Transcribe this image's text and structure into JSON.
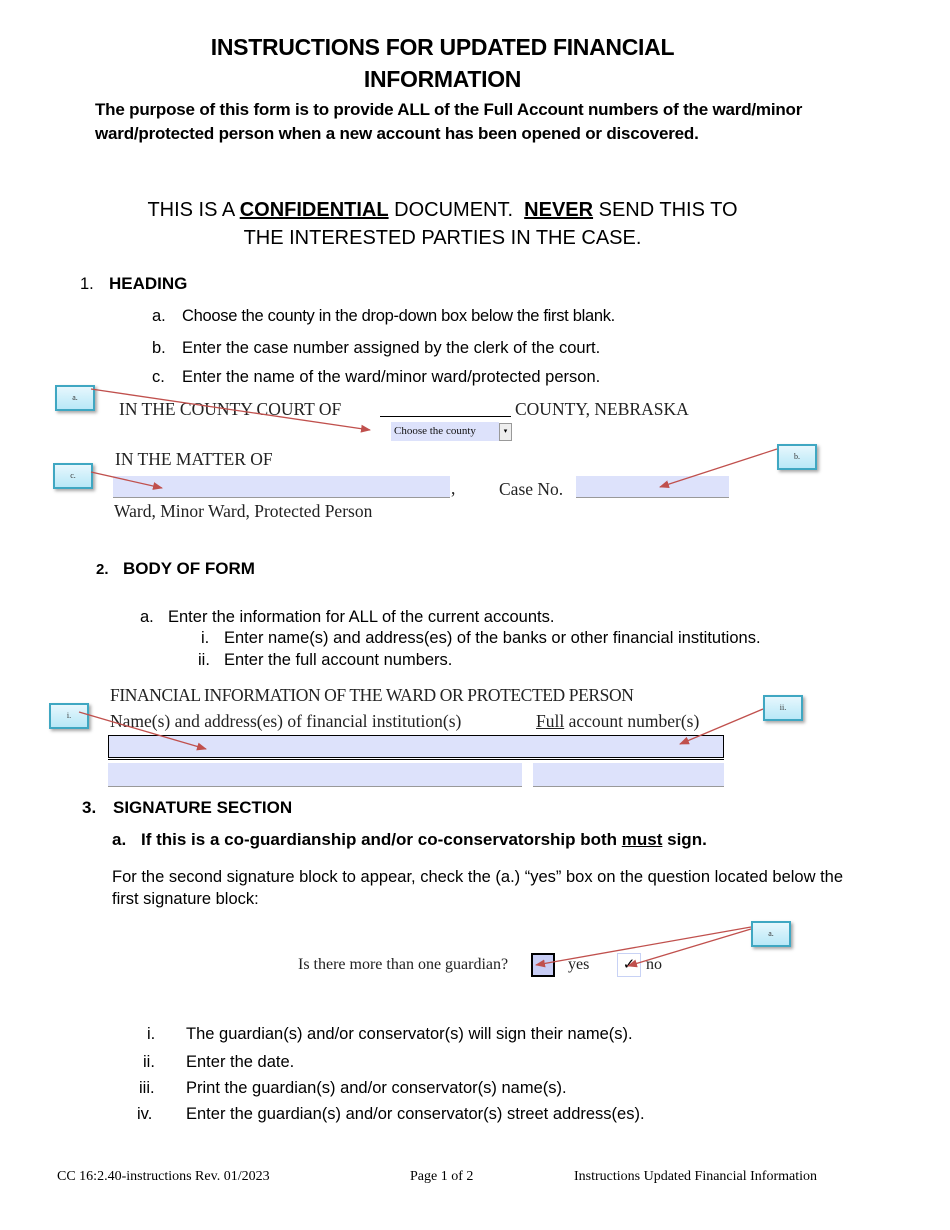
{
  "title": {
    "line1": "INSTRUCTIONS FOR UPDATED FINANCIAL",
    "line2": "INFORMATION"
  },
  "purpose": "The purpose of this form is to provide ALL of the Full Account numbers of the ward/minor ward/protected person when a new account has been opened or discovered.",
  "confidential": {
    "part1": "THIS IS A ",
    "word1": "CONFIDENTIAL",
    "part2": " DOCUMENT.  ",
    "word2": "NEVER",
    "part3": " SEND THIS TO",
    "line2": "THE INTERESTED PARTIES IN THE CASE."
  },
  "section1": {
    "number": "1.",
    "heading": "HEADING",
    "items": [
      {
        "marker": "a.",
        "text": "Choose the county in the drop-down box below the first blank."
      },
      {
        "marker": "b.",
        "text": "Enter the case number assigned by the clerk of the court."
      },
      {
        "marker": "c.",
        "text": "Enter the name of the ward/minor ward/protected person."
      }
    ],
    "sample": {
      "court_prefix": "IN THE  COUNTY   COURT OF",
      "court_suffix": "COUNTY, NEBRASKA",
      "county_dropdown": "Choose the county",
      "matter_of": "IN THE MATTER OF",
      "comma": ",",
      "case_no_label": "Case No.",
      "ward_caption": "Ward, Minor Ward, Protected Person",
      "callouts": [
        "a.",
        "b.",
        "c."
      ]
    }
  },
  "section2": {
    "number": "2.",
    "heading": "BODY OF FORM",
    "item_a": {
      "marker": "a.",
      "text": "Enter the information for ALL of the current accounts."
    },
    "subitems": [
      {
        "marker": "i.",
        "text": "Enter name(s) and address(es) of the banks or other financial institutions."
      },
      {
        "marker": "ii.",
        "text": "Enter the full account numbers."
      }
    ],
    "sample": {
      "title": "FINANCIAL INFORMATION OF THE WARD OR PROTECTED PERSON",
      "col1": "Name(s) and address(es) of financial institution(s)",
      "col2_underlined": "Full",
      "col2_rest": " account number(s)",
      "callouts": [
        "i.",
        "ii."
      ]
    }
  },
  "section3": {
    "number": "3.",
    "heading": "SIGNATURE SECTION",
    "item_a": {
      "marker": "a.",
      "pre": "If this is a co-guardianship and/or co-conservatorship both ",
      "underlined": "must",
      "post": " sign."
    },
    "para": "For the second signature block to appear, check the (a.) “yes” box on the question located below the first signature block:",
    "sample": {
      "question": "Is there more than one guardian?",
      "yes_label": "yes",
      "no_label": "no",
      "yes_checked": false,
      "no_checked": true,
      "check_glyph": "✓",
      "callout": "a."
    },
    "subitems": [
      {
        "marker": "i.",
        "text": "The guardian(s) and/or conservator(s) will sign their name(s)."
      },
      {
        "marker": "ii.",
        "text": "Enter the date."
      },
      {
        "marker": "iii.",
        "text": "Print the guardian(s) and/or conservator(s) name(s)."
      },
      {
        "marker": "iv.",
        "text": "Enter the guardian(s) and/or conservator(s) street address(es)."
      }
    ]
  },
  "footer": {
    "left": "CC 16:2.40-instructions Rev. 01/2023",
    "center": "Page 1 of 2",
    "right": "Instructions Updated Financial Information"
  },
  "colors": {
    "field_fill": "#dde2fb",
    "arrow": "#c0504d",
    "callout_border": "#3fa7c2"
  }
}
